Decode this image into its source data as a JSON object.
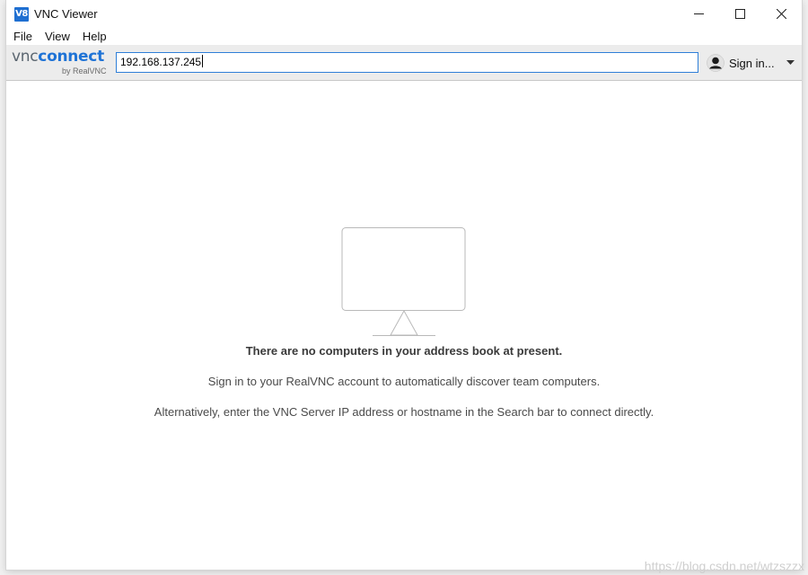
{
  "window": {
    "title": "VNC Viewer",
    "icon_text": "V8"
  },
  "menu": {
    "items": [
      "File",
      "View",
      "Help"
    ]
  },
  "toolbar": {
    "brand_vnc": "vnc",
    "brand_connect": "connect",
    "brand_sub": "by RealVNC",
    "search_value": "192.168.137.245",
    "signin_label": "Sign in..."
  },
  "main": {
    "empty_title": "There are no computers in your address book at present.",
    "line1": "Sign in to your RealVNC account to automatically discover team computers.",
    "line2": "Alternatively, enter the VNC Server IP address or hostname in the Search bar to connect directly."
  },
  "watermark": "https://blog.csdn.net/wtzszzx",
  "colors": {
    "accent": "#1f73d6",
    "toolbar_bg": "#ececec",
    "search_border": "#2f7fd8"
  },
  "icons": {
    "app": "vnc-viewer-icon",
    "minimize": "minimize-icon",
    "maximize": "maximize-icon",
    "close": "close-icon",
    "user": "user-avatar-icon",
    "dropdown": "chevron-down-icon",
    "empty_state": "monitor-icon"
  }
}
